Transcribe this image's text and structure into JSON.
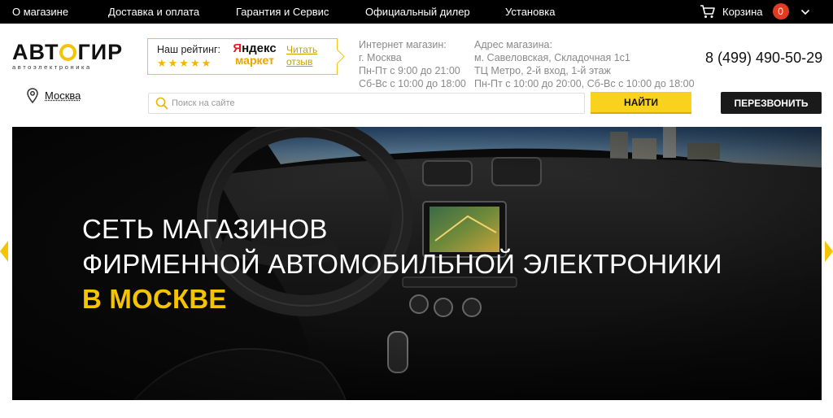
{
  "nav": {
    "items": [
      "О магазине",
      "Доставка и оплата",
      "Гарантия и Сервис",
      "Официальный дилер",
      "Установка"
    ],
    "cart_label": "Корзина",
    "cart_count": "0"
  },
  "logo": {
    "text_left": "АВТ",
    "text_right": "ГИР",
    "subtitle": "автоэлектроника"
  },
  "rating": {
    "title": "Наш рейтинг:",
    "stars": "★★★★★",
    "yandex_prefix": "Я",
    "yandex_rest": "ндекс",
    "yandex_market": "маркет",
    "review_line1": "Читать",
    "review_line2": "отзыв"
  },
  "online_shop": {
    "line1": "Интернет магазин:",
    "line2": "г. Москва",
    "line3": "Пн-Пт с 9:00 до 21:00",
    "line4": "Сб-Вс с 10:00 до 18:00"
  },
  "address": {
    "line1": "Адрес магазина:",
    "line2": "м. Савеловская, Складочная 1с1",
    "line3": "ТЦ Метро, 2-й вход, 1-й этаж",
    "line4": "Пн-Пт с 10:00 до 20:00, Сб-Вс с 10:00 до 18:00"
  },
  "phone": "8 (499) 490-50-29",
  "city": "Москва",
  "search": {
    "placeholder": "Поиск на сайте",
    "value": ""
  },
  "buttons": {
    "find": "НАЙТИ",
    "callback": "ПЕРЕЗВОНИТЬ"
  },
  "hero": {
    "line1": "СЕТЬ МАГАЗИНОВ",
    "line2": "ФИРМЕННОЙ АВТОМОБИЛЬНОЙ ЭЛЕКТРОНИКИ",
    "line3": "В МОСКВЕ"
  },
  "colors": {
    "accent": "#f5c400",
    "badge": "#e23b22",
    "dark": "#1a1a1a"
  }
}
